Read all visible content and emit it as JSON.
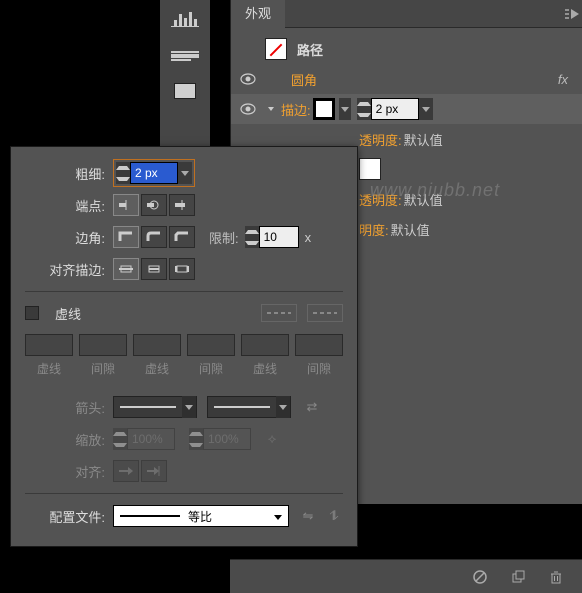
{
  "appearance": {
    "tab": "外观",
    "path_label": "路径",
    "rounded_label": "圆角",
    "stroke_label": "描边:",
    "stroke_value": "2 px",
    "opacity_rows": [
      {
        "label": "透明度:",
        "value": "默认值"
      },
      {
        "label": "透明度:",
        "value": "默认值"
      },
      {
        "label": "明度:",
        "value": "默认值"
      }
    ]
  },
  "stroke_panel": {
    "weight_label": "粗细:",
    "weight_value": "2 px",
    "cap_label": "端点:",
    "corner_label": "边角:",
    "limit_label": "限制:",
    "limit_value": "10",
    "limit_suffix": "x",
    "align_label": "对齐描边:",
    "dashed_label": "虚线",
    "dash_caps": [
      "虚线",
      "间隙",
      "虚线",
      "间隙",
      "虚线",
      "间隙"
    ],
    "arrow_label": "箭头:",
    "scale_label": "缩放:",
    "scale_value": "100%",
    "align_arrow_label": "对齐:",
    "profile_label": "配置文件:",
    "profile_value": "等比"
  },
  "watermark": "www.niubb.net"
}
